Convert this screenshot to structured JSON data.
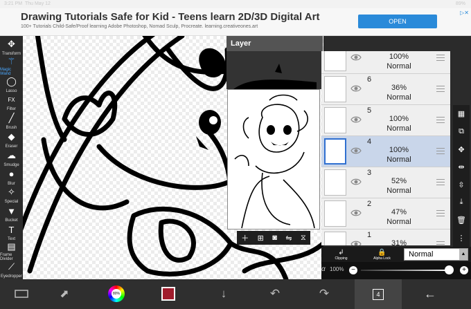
{
  "status": {
    "time": "3:21 PM",
    "date": "Thu May 12",
    "battery": "89%"
  },
  "ad": {
    "title": "Drawing Tutorials Safe for Kid - Teens learn 2D/3D Digital Art",
    "subtitle": "100+ Tutorials Child-Safe/Proof learning Adobe Photoshop, Nomad Sculp, Procreate. learning.creativeones.art",
    "button": "OPEN"
  },
  "tools": [
    {
      "label": "Transform",
      "icon": "move-icon"
    },
    {
      "label": "Magic Wand",
      "icon": "magic-wand-icon"
    },
    {
      "label": "Lasso",
      "icon": "lasso-icon"
    },
    {
      "label": "Filter",
      "icon": "fx-icon"
    },
    {
      "label": "Brush",
      "icon": "brush-icon"
    },
    {
      "label": "Eraser",
      "icon": "eraser-icon"
    },
    {
      "label": "Smudge",
      "icon": "smudge-icon"
    },
    {
      "label": "Blur",
      "icon": "blur-icon"
    },
    {
      "label": "Special",
      "icon": "special-icon"
    },
    {
      "label": "Bucket",
      "icon": "bucket-icon"
    },
    {
      "label": "Text",
      "icon": "text-icon"
    },
    {
      "label": "Frame Divider",
      "icon": "frame-divider-icon"
    },
    {
      "label": "Eyedropper",
      "icon": "eyedropper-icon"
    }
  ],
  "layer_panel": {
    "title": "Layer",
    "layers": [
      {
        "num": "",
        "opacity": "100%",
        "mode": "Normal",
        "visible": true
      },
      {
        "num": "6",
        "opacity": "36%",
        "mode": "Normal",
        "visible": true
      },
      {
        "num": "5",
        "opacity": "100%",
        "mode": "Normal",
        "visible": true
      },
      {
        "num": "4",
        "opacity": "100%",
        "mode": "Normal",
        "visible": true,
        "selected": true
      },
      {
        "num": "3",
        "opacity": "52%",
        "mode": "Normal",
        "visible": true
      },
      {
        "num": "2",
        "opacity": "47%",
        "mode": "Normal",
        "visible": true
      },
      {
        "num": "1",
        "opacity": "31%",
        "mode": "Normal",
        "visible": true
      }
    ],
    "clipping_label": "Clipping",
    "alpha_lock_label": "Alpha Lock",
    "blend_mode": "Normal",
    "opacity_symbol": "α",
    "opacity_value": "100%"
  },
  "bottombar": {
    "color_wheel_label": "80%",
    "layer_count": "4"
  },
  "colors": {
    "accent": "#4aa8ff",
    "current_color": "#a01c2c"
  }
}
